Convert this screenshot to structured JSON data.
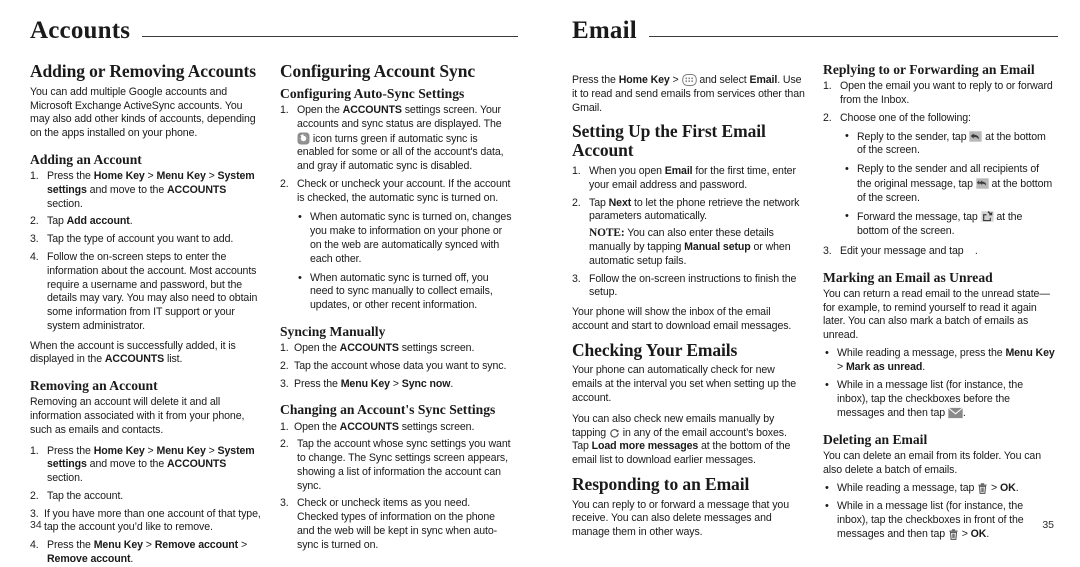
{
  "left_page": {
    "running_head": "Accounts",
    "page_number": "34",
    "col1": {
      "h_adding_removing": "Adding or Removing Accounts",
      "intro": "You can add multiple Google accounts and Microsoft Exchange ActiveSync accounts. You may also add other kinds of accounts, depending on the apps installed on your phone.",
      "h_adding": "Adding an Account",
      "steps": [
        "Press the Home Key > Menu Key > System settings and move to the ACCOUNTS section.",
        "Tap Add account.",
        "Tap the type of account you want to add.",
        "Follow the on-screen steps to enter the information about the account. Most accounts require a username and password, but the details may vary. You may also need to obtain some information from IT support or your system administrator."
      ],
      "after_steps": "When the account is successfully added, it is displayed in the ACCOUNTS list.",
      "h_removing": "Removing an Account",
      "removing_intro": "Removing an account will delete it and all information associated with it from your phone, such as emails and contacts.",
      "removing_steps": [
        "Press the Home Key > Menu Key > System settings and move to the ACCOUNTS section.",
        "Tap the account.",
        "If you have more than one account of that type, tap the account you'd like to remove.",
        "Press the Menu Key > Remove account > Remove account."
      ]
    },
    "col2": {
      "h_config_sync": "Configuring Account Sync",
      "h_auto_sync": "Configuring Auto-Sync Settings",
      "auto_steps": [
        "Open the ACCOUNTS settings screen. Your accounts and sync status are displayed. The [sync-icon] icon turns green if automatic sync is enabled for some or all of the account's data, and gray if automatic sync is disabled.",
        "Check or uncheck your account. If the account is checked, the automatic sync is turned on."
      ],
      "auto_bullets": [
        "When automatic sync is turned on, changes you make to information on your phone or on the web are automatically synced with each other.",
        "When automatic sync is turned off, you need to sync manually to collect emails, updates, or other recent information."
      ],
      "h_sync_manual": "Syncing Manually",
      "manual_steps": [
        "Open the ACCOUNTS settings screen.",
        "Tap the account whose data you want to sync.",
        "Press the Menu Key > Sync now."
      ],
      "h_change_sync": "Changing an Account's Sync Settings",
      "change_steps": [
        "Open the ACCOUNTS settings screen.",
        "Tap the account whose sync settings you want to change. The Sync settings screen appears, showing a list of information the account can sync.",
        "Check or uncheck items as you need. Checked types of information on the phone and the web will be kept in sync when auto-sync is turned on."
      ]
    }
  },
  "right_page": {
    "running_head": "Email",
    "page_number": "35",
    "col1": {
      "intro": "Press the Home Key > [apps-icon] and select Email. Use it to read and send emails from services other than Gmail.",
      "h_setting_up": "Setting Up the First Email Account",
      "setup_steps": [
        "When you open Email for the first time, enter your email address and password.",
        "Tap Next to let the phone retrieve the network parameters automatically.",
        "Follow the on-screen instructions to finish the setup."
      ],
      "note_label": "NOTE:",
      "note_text": "You can also enter these details manually by tapping Manual setup or when automatic setup fails.",
      "after_setup": "Your phone will show the inbox of the email account and start to download email messages.",
      "h_checking": "Checking Your Emails",
      "checking_p1": "Your phone can automatically check for new emails at the interval you set when setting up the account.",
      "checking_p2": "You can also check new emails manually by tapping [refresh-icon] in any of the email account's boxes. Tap Load more messages at the bottom of the email list to download earlier messages.",
      "h_responding": "Responding to an Email",
      "responding_p": "You can reply to or forward a message that you receive. You can also delete messages and manage them in other ways."
    },
    "col2": {
      "h_replying": "Replying to or Forwarding an Email",
      "reply_steps": [
        "Open the email you want to reply to or forward from the Inbox.",
        "Choose one of the following:",
        "Edit your message and tap ."
      ],
      "reply_bullets": [
        "Reply to the sender, tap [reply-icon] at the bottom of the screen.",
        "Reply to the sender and all recipients of the original message, tap [reply-all-icon] at the bottom of the screen.",
        "Forward the message, tap [forward-icon] at the bottom of the screen."
      ],
      "h_marking": "Marking an Email as Unread",
      "marking_p": "You can return a read email to the unread state—for example, to remind yourself to read it again later. You can also mark a batch of emails as unread.",
      "marking_bullets": [
        "While reading a message, press the Menu Key > Mark as unread.",
        "While in a message list (for instance, the inbox), tap the checkboxes before the messages and then tap [envelope-icon]."
      ],
      "h_deleting": "Deleting an Email",
      "deleting_p": "You can delete an email from its folder. You can also delete a batch of emails.",
      "deleting_bullets": [
        "While reading a message, tap [trash-icon] > OK.",
        "While in a message list (for instance, the inbox), tap the checkboxes in front of the messages and then tap [trash-icon] > OK."
      ]
    }
  },
  "icons": {
    "sync": "sync-icon",
    "apps": "apps-grid-icon",
    "refresh": "refresh-icon",
    "reply": "reply-icon",
    "reply_all": "reply-all-icon",
    "forward": "forward-icon",
    "envelope": "envelope-icon",
    "trash": "trash-icon"
  },
  "colors": {
    "text": "#1a1a1a",
    "rule": "#3a3a3a",
    "icon_fill": "#8d8d8d",
    "page_bg": "#ffffff"
  }
}
